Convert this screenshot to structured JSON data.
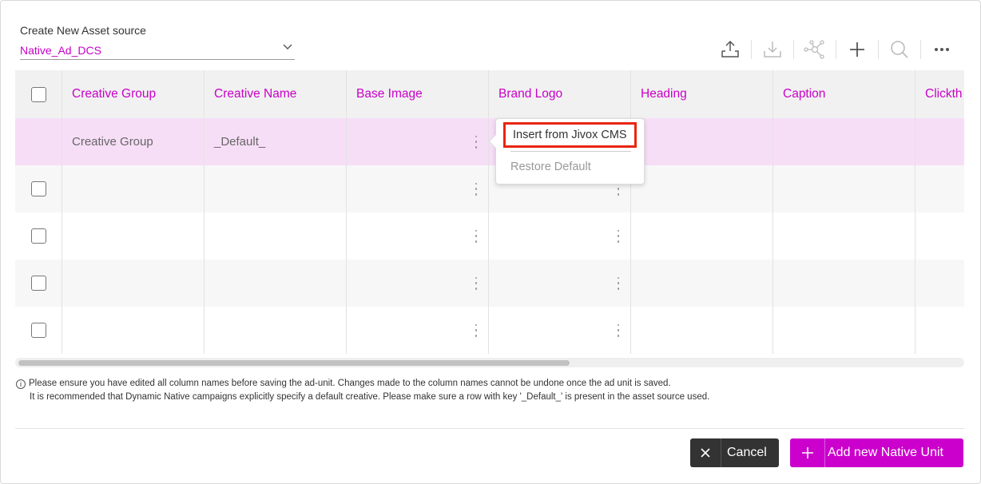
{
  "source": {
    "label": "Create New Asset source",
    "value": "Native_Ad_DCS"
  },
  "toolbar": {
    "icons": [
      "upload-icon",
      "download-icon",
      "network-icon",
      "plus-icon",
      "search-icon",
      "more-icon"
    ]
  },
  "table": {
    "columns": [
      "Creative Group",
      "Creative Name",
      "Base Image",
      "Brand Logo",
      "Heading",
      "Caption",
      "Clickth"
    ],
    "default_row": {
      "creative_group": "Creative Group",
      "creative_name": "_Default_"
    }
  },
  "menu": {
    "insert": "Insert from Jivox CMS",
    "restore": "Restore Default"
  },
  "notes": {
    "line1": "Please ensure you have edited all column names before saving the ad-unit. Changes made to the column names cannot be undone once the ad unit is saved.",
    "line2": "It is recommended that Dynamic Native campaigns explicitly specify a default creative. Please make sure a row with key '_Default_' is present in the asset source used."
  },
  "footer": {
    "cancel_label": "Cancel",
    "add_label": "Add new Native Unit"
  },
  "colors": {
    "accent": "#cc00cc",
    "highlight": "#e8250c",
    "default_row": "#f7def7"
  }
}
